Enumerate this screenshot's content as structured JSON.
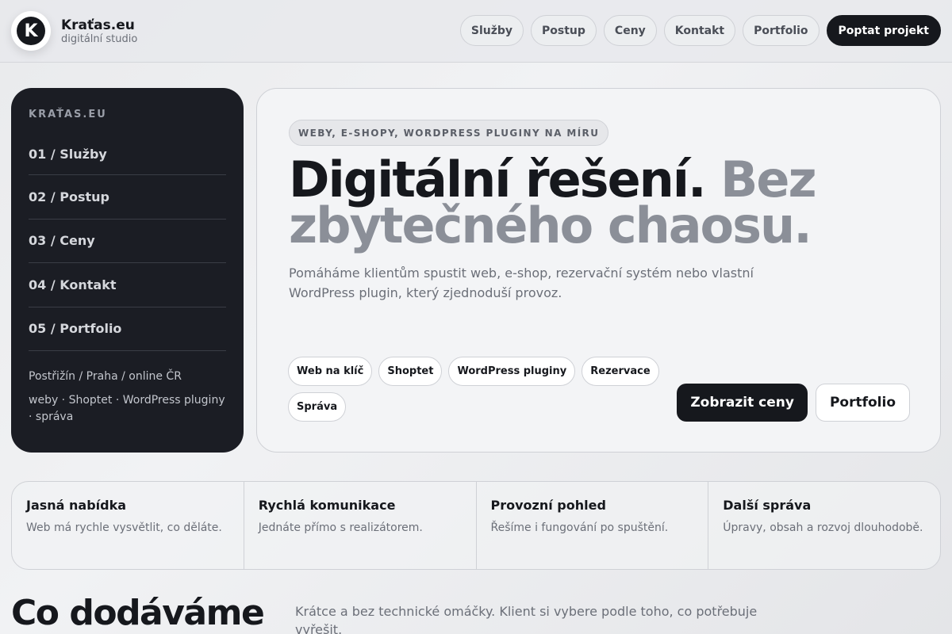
{
  "header": {
    "logo_letter": "K",
    "brand_name": "Kraťas.eu",
    "brand_sub": "digitální studio",
    "nav": [
      "Služby",
      "Postup",
      "Ceny",
      "Kontakt",
      "Portfolio"
    ],
    "cta": "Poptat projekt"
  },
  "sidebar": {
    "title": "KRAŤAS.EU",
    "items": [
      "01 / Služby",
      "02 / Postup",
      "03 / Ceny",
      "04 / Kontakt",
      "05 / Portfolio"
    ],
    "location": "Postřižín / Praha / online ČR",
    "tags": "weby · Shoptet · WordPress pluginy · správa"
  },
  "hero": {
    "pill": "WEBY, E-SHOPY, WORDPRESS PLUGINY NA MÍRU",
    "headline_dark": "Digitální řešení.",
    "headline_muted": "Bez zbytečného chaosu.",
    "lead": "Pomáháme klientům spustit web, e-shop, rezervační systém nebo vlastní WordPress plugin, který zjednoduší provoz.",
    "tags": [
      "Web na klíč",
      "Shoptet",
      "WordPress pluginy",
      "Rezervace",
      "Správa"
    ],
    "primary_btn": "Zobrazit ceny",
    "secondary_btn": "Portfolio"
  },
  "features": [
    {
      "title": "Jasná nabídka",
      "desc": "Web má rychle vysvětlit, co děláte."
    },
    {
      "title": "Rychlá komunikace",
      "desc": "Jednáte přímo s realizátorem."
    },
    {
      "title": "Provozní pohled",
      "desc": "Řešíme i fungování po spuštění."
    },
    {
      "title": "Další správa",
      "desc": "Úpravy, obsah a rozvoj dlouhodobě."
    }
  ],
  "section": {
    "title": "Co dodáváme",
    "lead": "Krátce a bez technické omáčky. Klient si vybere podle toho, co potřebuje vyřešit."
  }
}
